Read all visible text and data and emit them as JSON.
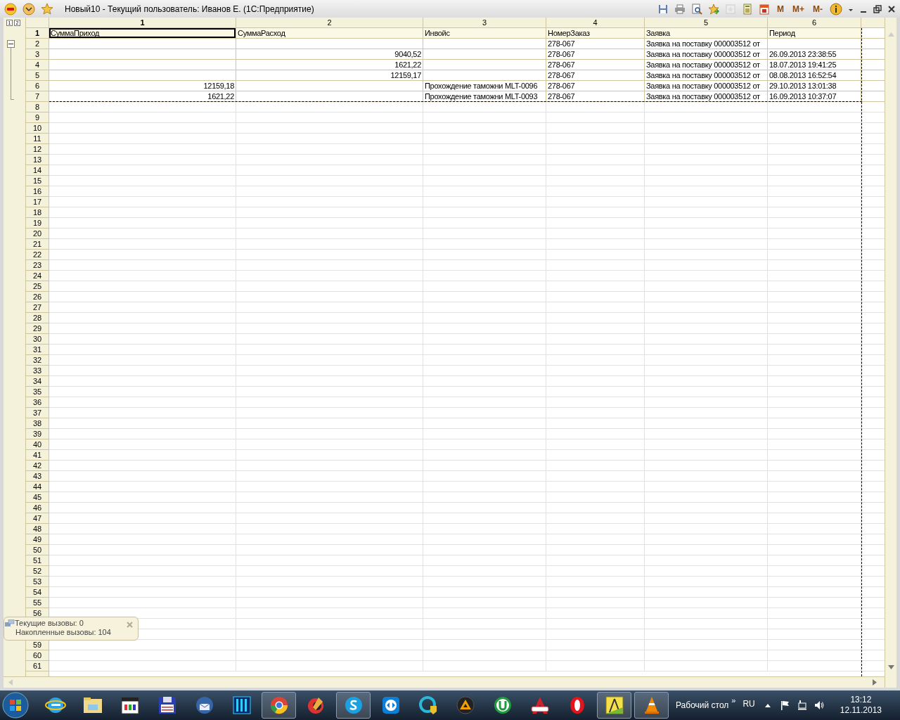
{
  "window": {
    "title": "Новый10 - Текущий пользователь: Иванов Е.  (1С:Предприятие)"
  },
  "toolbar": {
    "memory_buttons": [
      "M",
      "M+",
      "M-"
    ]
  },
  "group_levels": [
    "1",
    "2"
  ],
  "group": {
    "expanded": true
  },
  "columns": [
    {
      "label": "1",
      "kind": "number",
      "selected": true
    },
    {
      "label": "2",
      "kind": "number",
      "selected": false
    },
    {
      "label": "3",
      "kind": "text",
      "selected": false
    },
    {
      "label": "4",
      "kind": "text",
      "selected": false
    },
    {
      "label": "5",
      "kind": "text",
      "selected": false
    },
    {
      "label": "6",
      "kind": "text",
      "selected": false
    }
  ],
  "rows": [
    {
      "number": "1",
      "kind": "header",
      "selected": true,
      "cells": [
        "СуммаПриход",
        "СуммаРасход",
        "Инвойс",
        "НомерЗаказ",
        "Заявка",
        "Период"
      ]
    },
    {
      "number": "2",
      "kind": "data",
      "selected": false,
      "cells": [
        "",
        "",
        "",
        "278-067",
        "Заявка на поставку 000003512 от",
        ""
      ]
    },
    {
      "number": "3",
      "kind": "data",
      "selected": false,
      "cells": [
        "",
        "9040,52",
        "",
        "278-067",
        "Заявка на поставку 000003512 от",
        "26.09.2013 23:38:55"
      ]
    },
    {
      "number": "4",
      "kind": "data",
      "selected": false,
      "cells": [
        "",
        "1621,22",
        "",
        "278-067",
        "Заявка на поставку 000003512 от",
        "18.07.2013 19:41:25"
      ]
    },
    {
      "number": "5",
      "kind": "data",
      "selected": false,
      "cells": [
        "",
        "12159,17",
        "",
        "278-067",
        "Заявка на поставку 000003512 от",
        "08.08.2013 16:52:54"
      ]
    },
    {
      "number": "6",
      "kind": "data",
      "selected": false,
      "cells": [
        "12159,18",
        "",
        "Прохождение таможни MLT-0096",
        "278-067",
        "Заявка на поставку 000003512 от",
        "29.10.2013 13:01:38"
      ]
    },
    {
      "number": "7",
      "kind": "data",
      "selected": false,
      "cells": [
        "1621,22",
        "",
        "Прохождение таможни MLT-0093",
        "278-067",
        "Заявка на поставку 000003512 от",
        "16.09.2013 10:37:07"
      ]
    },
    {
      "number": "8",
      "kind": "blank",
      "selected": false
    },
    {
      "number": "9",
      "kind": "blank",
      "selected": false
    },
    {
      "number": "10",
      "kind": "blank",
      "selected": false
    },
    {
      "number": "11",
      "kind": "blank",
      "selected": false
    },
    {
      "number": "12",
      "kind": "blank",
      "selected": false
    },
    {
      "number": "13",
      "kind": "blank",
      "selected": false
    },
    {
      "number": "14",
      "kind": "blank",
      "selected": false
    },
    {
      "number": "15",
      "kind": "blank",
      "selected": false
    },
    {
      "number": "16",
      "kind": "blank",
      "selected": false
    },
    {
      "number": "17",
      "kind": "blank",
      "selected": false
    },
    {
      "number": "18",
      "kind": "blank",
      "selected": false
    },
    {
      "number": "19",
      "kind": "blank",
      "selected": false
    },
    {
      "number": "20",
      "kind": "blank",
      "selected": false
    },
    {
      "number": "21",
      "kind": "blank",
      "selected": false
    },
    {
      "number": "22",
      "kind": "blank",
      "selected": false
    },
    {
      "number": "23",
      "kind": "blank",
      "selected": false
    },
    {
      "number": "24",
      "kind": "blank",
      "selected": false
    },
    {
      "number": "25",
      "kind": "blank",
      "selected": false
    },
    {
      "number": "26",
      "kind": "blank",
      "selected": false
    },
    {
      "number": "27",
      "kind": "blank",
      "selected": false
    },
    {
      "number": "28",
      "kind": "blank",
      "selected": false
    },
    {
      "number": "29",
      "kind": "blank",
      "selected": false
    },
    {
      "number": "30",
      "kind": "blank",
      "selected": false
    },
    {
      "number": "31",
      "kind": "blank",
      "selected": false
    },
    {
      "number": "32",
      "kind": "blank",
      "selected": false
    },
    {
      "number": "33",
      "kind": "blank",
      "selected": false
    },
    {
      "number": "34",
      "kind": "blank",
      "selected": false
    },
    {
      "number": "35",
      "kind": "blank",
      "selected": false
    },
    {
      "number": "36",
      "kind": "blank",
      "selected": false
    },
    {
      "number": "37",
      "kind": "blank",
      "selected": false
    },
    {
      "number": "38",
      "kind": "blank",
      "selected": false
    },
    {
      "number": "39",
      "kind": "blank",
      "selected": false
    },
    {
      "number": "40",
      "kind": "blank",
      "selected": false
    },
    {
      "number": "41",
      "kind": "blank",
      "selected": false
    },
    {
      "number": "42",
      "kind": "blank",
      "selected": false
    },
    {
      "number": "43",
      "kind": "blank",
      "selected": false
    },
    {
      "number": "44",
      "kind": "blank",
      "selected": false
    },
    {
      "number": "45",
      "kind": "blank",
      "selected": false
    },
    {
      "number": "46",
      "kind": "blank",
      "selected": false
    },
    {
      "number": "47",
      "kind": "blank",
      "selected": false
    },
    {
      "number": "48",
      "kind": "blank",
      "selected": false
    },
    {
      "number": "49",
      "kind": "blank",
      "selected": false
    },
    {
      "number": "50",
      "kind": "blank",
      "selected": false
    },
    {
      "number": "51",
      "kind": "blank",
      "selected": false
    },
    {
      "number": "52",
      "kind": "blank",
      "selected": false
    },
    {
      "number": "53",
      "kind": "blank",
      "selected": false
    },
    {
      "number": "54",
      "kind": "blank",
      "selected": false
    },
    {
      "number": "55",
      "kind": "blank",
      "selected": false
    },
    {
      "number": "56",
      "kind": "blank",
      "selected": false
    },
    {
      "kind": "blank"
    },
    {
      "kind": "blank"
    },
    {
      "number": "59",
      "kind": "blank",
      "selected": false
    },
    {
      "number": "60",
      "kind": "blank",
      "selected": false
    },
    {
      "number": "61",
      "kind": "blank",
      "selected": false
    }
  ],
  "notification": {
    "lines": [
      "Текущие вызовы: 0",
      "Накопленные вызовы: 104"
    ]
  },
  "taskbar": {
    "apps": [
      {
        "running": false
      },
      {
        "running": false
      },
      {
        "running": false
      },
      {
        "running": false
      },
      {
        "running": false
      },
      {
        "running": false
      },
      {
        "running": true
      },
      {
        "running": false
      },
      {
        "running": true
      },
      {
        "running": false
      },
      {
        "running": false
      },
      {
        "running": false
      },
      {
        "running": false
      },
      {
        "running": false
      },
      {
        "running": false
      },
      {
        "running": true
      },
      {
        "running": true
      }
    ],
    "desktop_label": "Рабочий стол",
    "chevron": "»",
    "language": "RU",
    "time": "13:12",
    "date": "12.11.2013"
  }
}
